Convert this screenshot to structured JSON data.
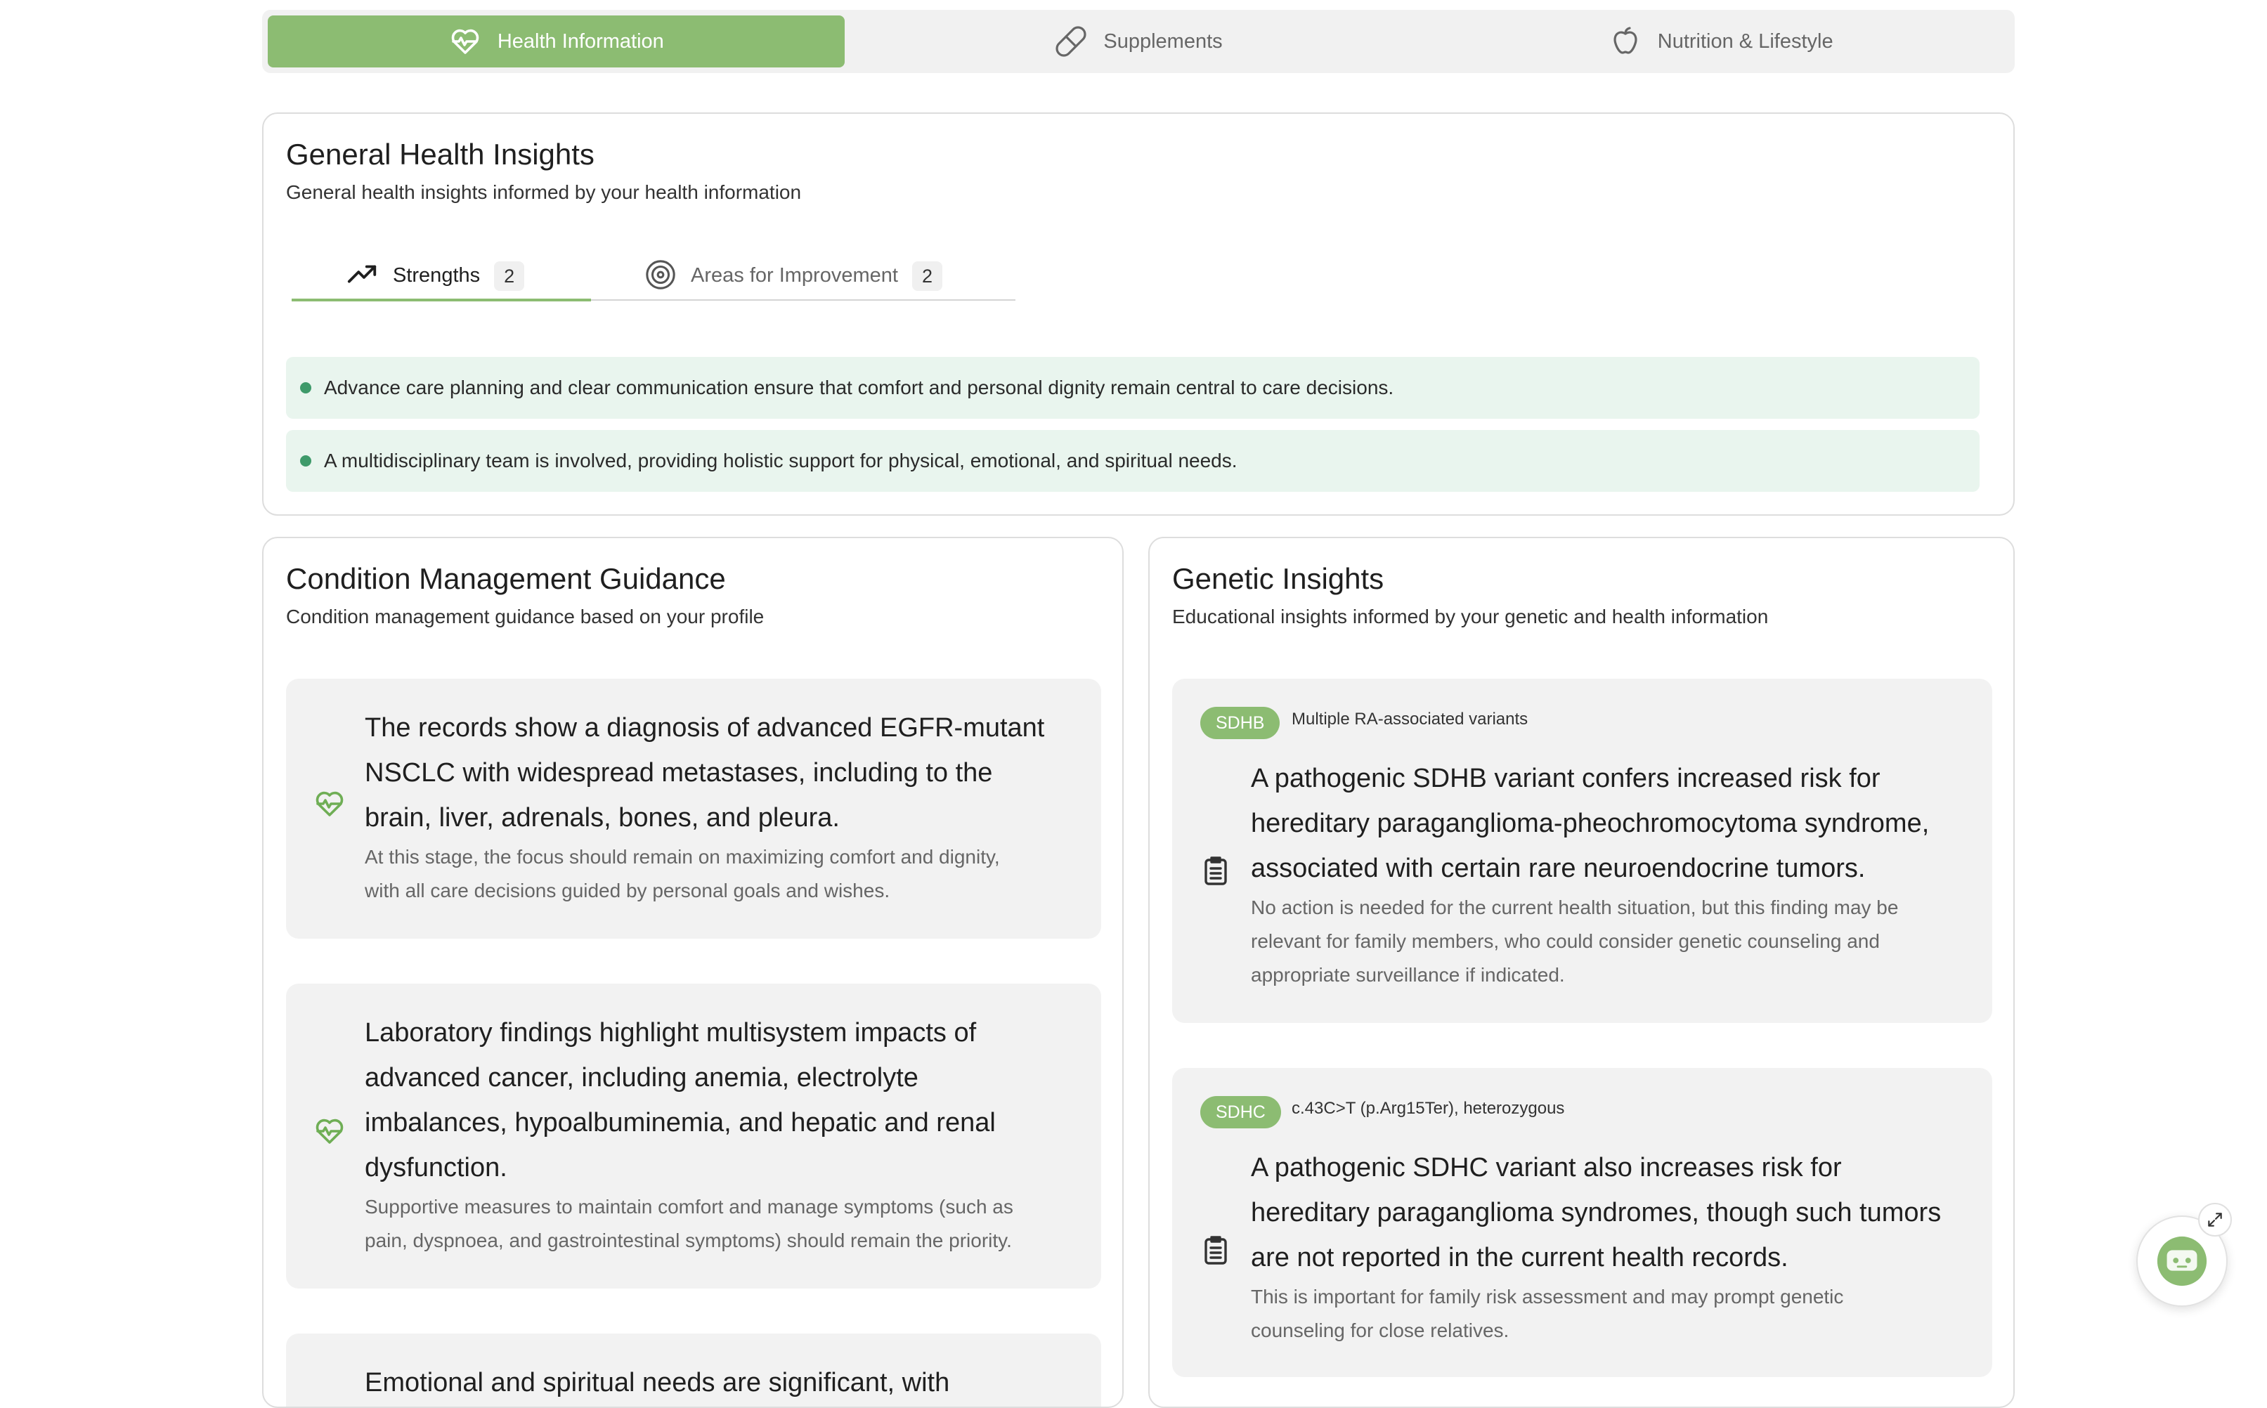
{
  "top_tabs": {
    "health": "Health Information",
    "supplements": "Supplements",
    "nutrition": "Nutrition & Lifestyle"
  },
  "general": {
    "title": "General Health Insights",
    "subtitle": "General health insights informed by your health information",
    "tabs": {
      "strengths_label": "Strengths",
      "strengths_count": "2",
      "improvement_label": "Areas for Improvement",
      "improvement_count": "2"
    },
    "strengths": [
      "Advance care planning and clear communication ensure that comfort and personal dignity remain central to care decisions.",
      "A multidisciplinary team is involved, providing holistic support for physical, emotional, and spiritual needs."
    ]
  },
  "condition": {
    "title": "Condition Management Guidance",
    "subtitle": "Condition management guidance based on your profile",
    "items": [
      {
        "main": [
          "The records show a diagnosis of advanced EGFR-mutant",
          "NSCLC with widespread metastases, including to the",
          "brain, liver, adrenals, bones, and pleura."
        ],
        "sub": [
          "At this stage, the focus should remain on maximizing comfort and dignity,",
          "with all care decisions guided by personal goals and wishes."
        ]
      },
      {
        "main": [
          "Laboratory findings highlight multisystem impacts of",
          "advanced cancer, including anemia, electrolyte",
          "imbalances, hypoalbuminemia, and hepatic and renal",
          "dysfunction."
        ],
        "sub": [
          "Supportive measures to maintain comfort and manage symptoms (such as",
          "pain, dyspnoea, and gastrointestinal symptoms) should remain the priority."
        ]
      },
      {
        "main": [
          "Emotional and spiritual needs are significant, with"
        ]
      }
    ]
  },
  "genetic": {
    "title": "Genetic Insights",
    "subtitle": "Educational insights informed by your genetic and health information",
    "items": [
      {
        "gene": "SDHB",
        "variant": "Multiple RA-associated variants",
        "main": [
          "A pathogenic SDHB variant confers increased risk for",
          "hereditary paraganglioma-pheochromocytoma syndrome,",
          "associated with certain rare neuroendocrine tumors."
        ],
        "sub": [
          "No action is needed for the current health situation, but this finding may be",
          "relevant for family members, who could consider genetic counseling and",
          "appropriate surveillance if indicated."
        ]
      },
      {
        "gene": "SDHC",
        "variant": "c.43C>T (p.Arg15Ter), heterozygous",
        "main": [
          "A pathogenic SDHC variant also increases risk for",
          "hereditary paraganglioma syndromes, though such tumors",
          "are not reported in the current health records."
        ],
        "sub": [
          "This is important for family risk assessment and may prompt genetic",
          "counseling for close relatives."
        ]
      }
    ]
  },
  "colors": {
    "accent_green": "#8cbc72",
    "strength_bg": "#e9f5ee",
    "strength_dot": "#3e9a6a",
    "item_bg": "#f2f2f2"
  },
  "icons": {
    "health_tab": "heart-pulse-icon",
    "supplements_tab": "pill-icon",
    "nutrition_tab": "apple-icon",
    "strengths_tab": "trending-up-icon",
    "improvement_tab": "target-icon",
    "condition_item": "heart-pulse-icon",
    "genetic_item": "clipboard-icon",
    "chat": "chatbot-icon",
    "expand": "expand-icon"
  }
}
